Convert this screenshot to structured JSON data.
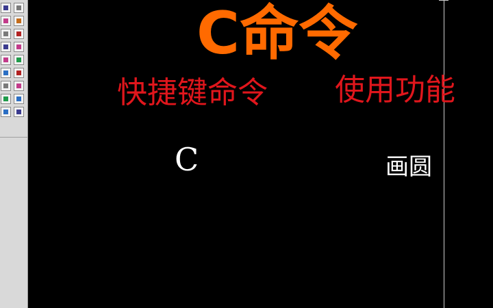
{
  "toolbar": {
    "icons_left": [
      "line-tool-icon",
      "arc-tool-icon",
      "layer-tool-icon",
      "scale-tool-icon",
      "polygon-tool-icon",
      "block-tool-icon",
      "text-tool-icon",
      "hatch-tool-icon",
      "dimension-tool-icon",
      "region-tool-icon"
    ],
    "icons_right": [
      "rectangle-tool-icon",
      "move-tool-icon",
      "mirror-tool-icon",
      "offset-tool-icon",
      "trim-tool-icon",
      "extend-tool-icon",
      "fillet-tool-icon",
      "chamfer-tool-icon",
      "explode-tool-icon"
    ]
  },
  "slide": {
    "title": "C命令",
    "subtitle_left": "快捷键命令",
    "subtitle_right": "使用功能",
    "command": "C",
    "command_function": "画圆"
  },
  "colors": {
    "title": "#ff6a00",
    "subtitle": "#e0161c",
    "body_text": "#ffffff",
    "background": "#000000"
  }
}
